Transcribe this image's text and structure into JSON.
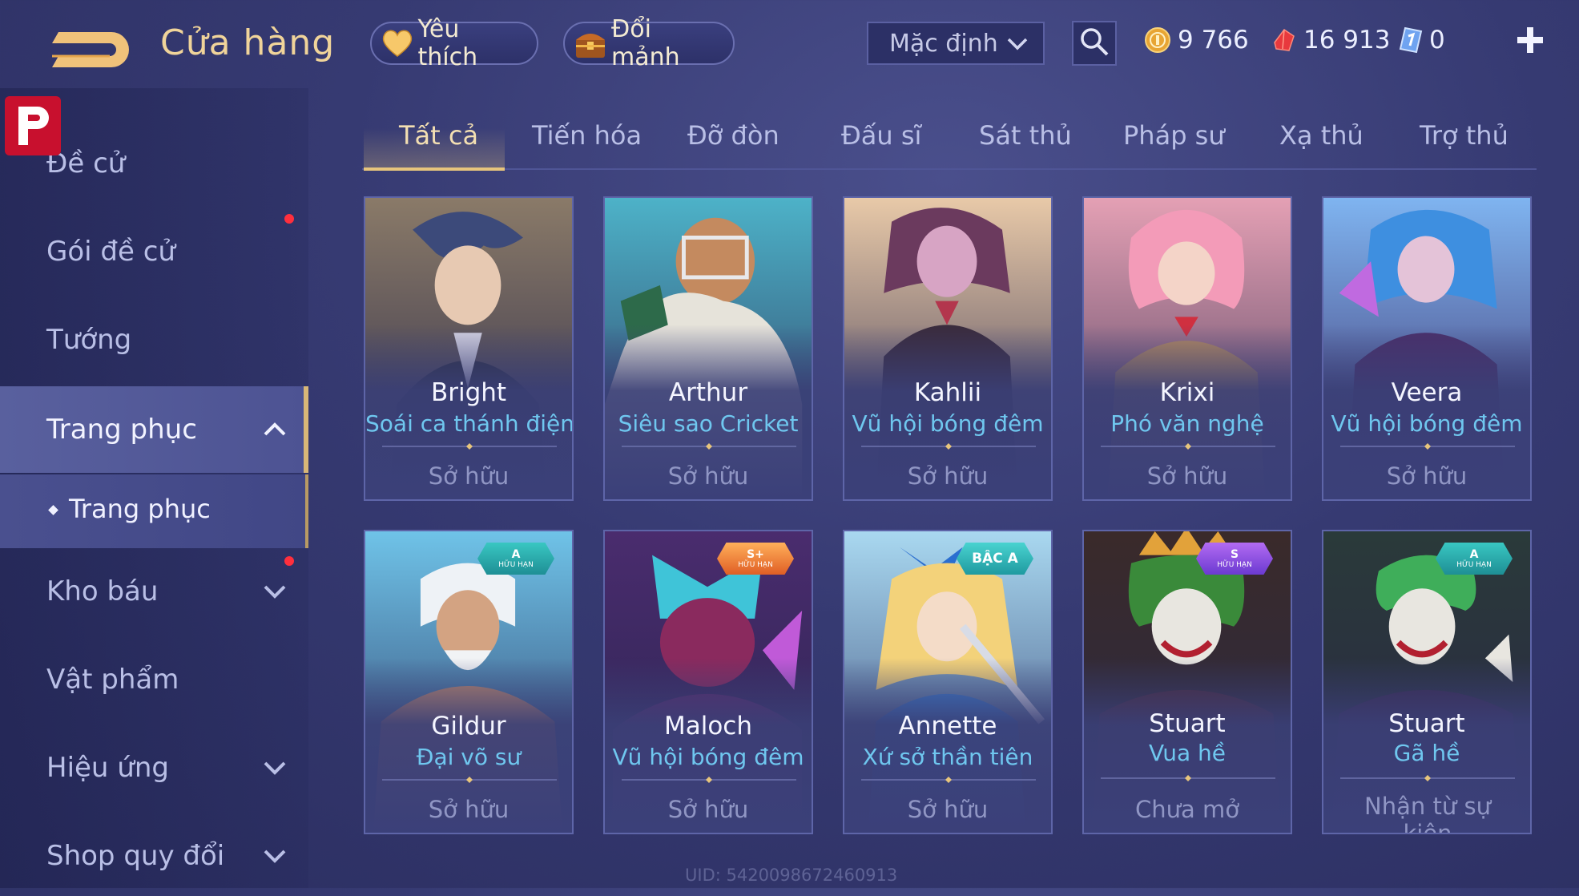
{
  "header": {
    "title": "Cửa hàng",
    "favorite_label": "Yêu thích",
    "fragment_label": "Đổi mảnh",
    "sort_value": "Mặc định",
    "currencies": [
      {
        "name": "gold-coin",
        "value": "9 766"
      },
      {
        "name": "ruby",
        "value": "16 913"
      },
      {
        "name": "voucher",
        "value": "0"
      }
    ]
  },
  "sidebar": {
    "items": [
      {
        "label": "Đề cử"
      },
      {
        "label": "Gói đề cử"
      },
      {
        "label": "Tướng"
      },
      {
        "label": "Trang phục"
      },
      {
        "label": "Kho báu"
      },
      {
        "label": "Vật phẩm"
      },
      {
        "label": "Hiệu ứng"
      },
      {
        "label": "Shop quy đổi"
      }
    ],
    "sub_item": "Trang phục"
  },
  "tabs": [
    "Tất cả",
    "Tiến hóa",
    "Đỡ đòn",
    "Đấu sĩ",
    "Sát thủ",
    "Pháp sư",
    "Xạ thủ",
    "Trợ thủ"
  ],
  "cards": [
    {
      "hero": "Bright",
      "skin": "Soái ca thánh điện",
      "status": "Sở hữu"
    },
    {
      "hero": "Arthur",
      "skin": "Siêu sao Cricket",
      "status": "Sở hữu"
    },
    {
      "hero": "Kahlii",
      "skin": "Vũ hội bóng đêm",
      "status": "Sở hữu"
    },
    {
      "hero": "Krixi",
      "skin": "Phó văn nghệ",
      "status": "Sở hữu"
    },
    {
      "hero": "Veera",
      "skin": "Vũ hội bóng đêm",
      "status": "Sở hữu"
    },
    {
      "hero": "Gildur",
      "skin": "Đại võ sư",
      "status": "Sở hữu",
      "tag": "A",
      "tag_sub": "HỮU HẠN"
    },
    {
      "hero": "Maloch",
      "skin": "Vũ hội bóng đêm",
      "status": "Sở hữu",
      "tag": "S+",
      "tag_sub": "HỮU HẠN"
    },
    {
      "hero": "Annette",
      "skin": "Xứ sở thần tiên",
      "status": "Sở hữu",
      "tag": "BẬC A"
    },
    {
      "hero": "Stuart",
      "skin": "Vua hề",
      "status": "Chưa mở",
      "tag": "S",
      "tag_sub": "HỮU HẠN"
    },
    {
      "hero": "Stuart",
      "skin": "Gã hề",
      "status": "Nhận từ sự kiện",
      "tag": "A",
      "tag_sub": "HỮU HẠN"
    }
  ],
  "footer": {
    "uid": "UID: 5420098672460913"
  },
  "colors": {
    "accent_gold": "#e7c57c",
    "skin_text": "#6fc7ef",
    "notification_red": "#ff2f3d"
  }
}
